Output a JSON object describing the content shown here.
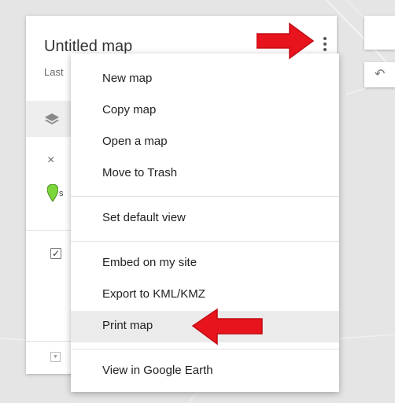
{
  "map": {
    "title": "Untitled map",
    "subtitle": "Last",
    "pin_letter": "s",
    "close_symbol": "×",
    "check_symbol": "✓",
    "back_icon": "arrow-left-icon",
    "back_symbol": "↶"
  },
  "menu": {
    "group1": [
      "New map",
      "Copy map",
      "Open a map",
      "Move to Trash"
    ],
    "group2": [
      "Set default view"
    ],
    "group3": [
      "Embed on my site",
      "Export to KML/KMZ",
      "Print map"
    ],
    "group4": [
      "View in Google Earth"
    ],
    "highlighted_item": "Print map"
  },
  "colors": {
    "arrow": "#e8141d",
    "menu_highlight": "#ebebeb",
    "pin": "#7cd53a"
  }
}
